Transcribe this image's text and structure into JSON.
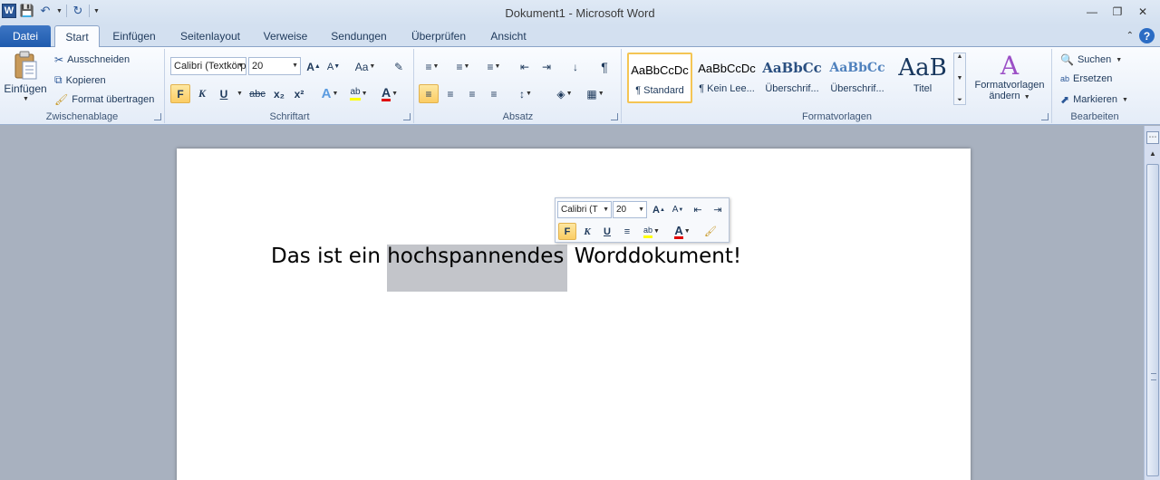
{
  "window": {
    "title": "Dokument1 - Microsoft Word",
    "logo": "W",
    "controls": [
      "minimize-icon",
      "restore-icon",
      "close-icon"
    ]
  },
  "quick_access": [
    "save-icon",
    "undo-icon",
    "redo-icon"
  ],
  "tabs": [
    {
      "label": "Datei"
    },
    {
      "label": "Start"
    },
    {
      "label": "Einfügen"
    },
    {
      "label": "Seitenlayout"
    },
    {
      "label": "Verweise"
    },
    {
      "label": "Sendungen"
    },
    {
      "label": "Überprüfen"
    },
    {
      "label": "Ansicht"
    }
  ],
  "ribbon": {
    "clipboard": {
      "label": "Zwischenablage",
      "paste": "Einfügen",
      "cut": "Ausschneiden",
      "copy": "Kopieren",
      "format_painter": "Format übertragen"
    },
    "font": {
      "label": "Schriftart",
      "font_name": "Calibri (Textkörper)",
      "font_size": "20",
      "bold": "F",
      "italic": "K",
      "underline": "U",
      "strike": "abc",
      "subscript": "x₂",
      "superscript": "x²",
      "change_case": "Aa",
      "font_color_letter": "A"
    },
    "paragraph": {
      "label": "Absatz",
      "show_marks": "¶"
    },
    "styles": {
      "label": "Formatvorlagen",
      "items": [
        {
          "preview": "AaBbCcDc",
          "name": "¶ Standard"
        },
        {
          "preview": "AaBbCcDc",
          "name": "¶ Kein Lee..."
        },
        {
          "preview": "AaBbCc",
          "name": "Überschrif..."
        },
        {
          "preview": "AaBbCc",
          "name": "Überschrif..."
        },
        {
          "preview": "AaB",
          "name": "Titel"
        }
      ],
      "change_line1": "Formatvorlagen",
      "change_line2": "ändern"
    },
    "editing": {
      "label": "Bearbeiten",
      "find": "Suchen",
      "replace": "Ersetzen",
      "select": "Markieren"
    }
  },
  "document": {
    "text_before": "Das ist ein ",
    "text_selected": "hochspannendes",
    "text_after": " Worddokument!"
  },
  "mini_toolbar": {
    "font_name": "Calibri (T",
    "font_size": "20",
    "bold": "F",
    "italic": "K",
    "underline": "U",
    "font_color_letter": "A"
  },
  "colors": {
    "accent_blue": "#2b5797",
    "file_tab": "#1f5bae",
    "selection_highlight": "#c3c5ca",
    "active_button": "#fbcd64",
    "font_color_red": "#e00000"
  }
}
